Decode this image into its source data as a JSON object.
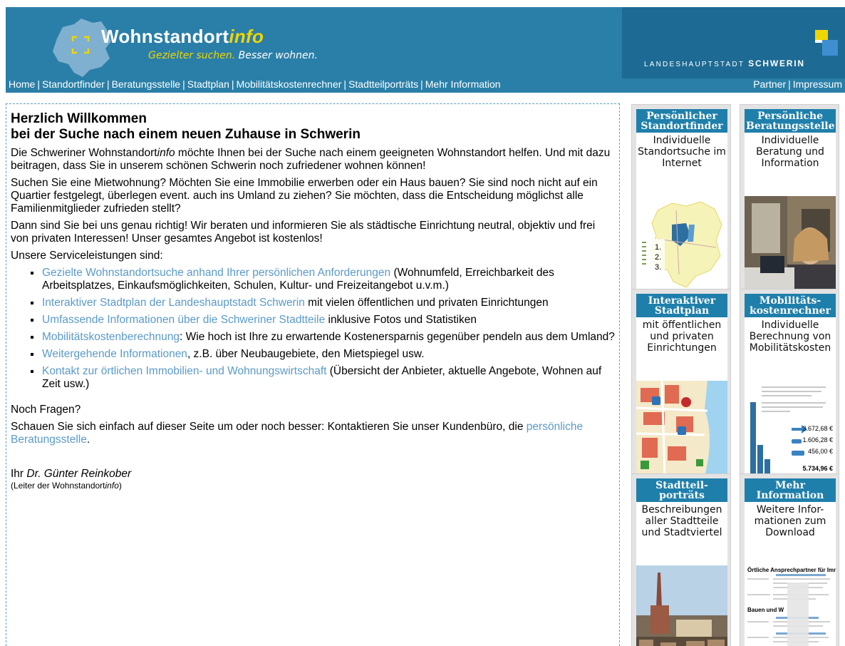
{
  "header": {
    "brand_main": "Wohnstandort",
    "brand_info": "info",
    "tagline_a": "Gezielter suchen.",
    "tagline_b": " Besser wohnen.",
    "city_prefix": "LANDESHAUPTSTADT",
    "city_name": "SCHWERIN",
    "logo_yellow": "#f1d500",
    "header_blue": "#2a7fa8"
  },
  "nav": {
    "left": [
      "Home",
      "Standortfinder",
      "Beratungsstelle",
      "Stadtplan",
      "Mobilitätskostenrechner",
      "Stadtteilporträts",
      "Mehr Information"
    ],
    "right": [
      "Partner",
      "Impressum"
    ],
    "separator": "|"
  },
  "main": {
    "title_line1": "Herzlich Willkommen",
    "title_line2": "bei der Suche nach einem neuen Zuhause in Schwerin",
    "p1_a": "Die Schweriner Wohnstandort",
    "p1_info": "info",
    "p1_b": " möchte Ihnen bei der Suche nach einem geeigneten Wohnstandort helfen. Und mit dazu beitragen, dass Sie in unserem schönen Schwerin noch zufriedener wohnen können!",
    "p2": "Suchen Sie eine Mietwohnung? Möchten Sie eine Immobilie erwerben oder ein Haus bauen? Sie sind noch nicht auf ein Quartier festgelegt, überlegen event. auch ins Umland zu ziehen? Sie möchten, dass die Entscheidung möglichst alle Familienmitglieder zufrieden stellt?",
    "p3": "Dann sind Sie bei uns genau richtig! Wir beraten und informieren Sie als städtische Einrichtung neutral, objektiv und frei von privaten Interessen! Unser gesamtes Angebot ist kostenlos!",
    "p4": "Unsere Serviceleistungen sind:",
    "services": [
      {
        "link": "Gezielte Wohnstandortsuche anhand Ihrer persönlichen Anforderungen",
        "text": " (Wohnumfeld, Erreichbarkeit des Arbeitsplatzes, Einkaufsmöglichkeiten, Schulen, Kultur- und Freizeitangebot u.v.m.)"
      },
      {
        "link": "Interaktiver Stadtplan der Landeshauptstadt Schwerin",
        "text": " mit vielen öffentlichen und privaten Einrichtungen"
      },
      {
        "link": "Umfassende Informationen über die Schweriner Stadtteile",
        "text": " inklusive Fotos und Statistiken"
      },
      {
        "link": "Mobilitätskostenberechnung",
        "text": ": Wie hoch ist Ihre zu erwartende Kostenersparnis gegenüber pendeln aus dem Umland?"
      },
      {
        "link": "Weitergehende Informationen",
        "text": ", z.B. über Neubaugebiete, den Mietspiegel usw."
      },
      {
        "link": "Kontakt zur örtlichen Immobilien- und Wohnungswirtschaft",
        "text": " (Übersicht der Anbieter, aktuelle Angebote, Wohnen auf Zeit usw.)"
      }
    ],
    "q_title": "Noch Fragen?",
    "q_text_a": "Schauen Sie sich einfach auf dieser Seite um oder noch besser: Kontaktieren Sie unser Kundenbüro, die ",
    "q_link": "persönliche Beratungsstelle",
    "q_text_b": ".",
    "sig_prefix": "Ihr ",
    "sig_name": "Dr. Günter Reinkober",
    "sig_role_a": "(Leiter der Wohnstandort",
    "sig_role_info": "info",
    "sig_role_b": ")",
    "link_color": "#5b9ac9"
  },
  "tiles": [
    {
      "title": "Persönlicher Standortfinder",
      "desc": "Individuelle Standortsuche im Internet",
      "image": "district-map-thumbnail",
      "map_labels": [
        "1.",
        "2.",
        "3."
      ]
    },
    {
      "title": "Persönliche Beratungsstelle",
      "desc": "Individuelle Beratung und Information",
      "image": "office-consultation-photo"
    },
    {
      "title": "Interaktiver Stadtplan",
      "desc": "mit öffentlichen und privaten Einrichtungen",
      "image": "city-map-thumbnail"
    },
    {
      "title": "Mobilitäts-kostenrechner",
      "desc": "Individuelle Berechnung von Mobilitätskosten",
      "image": "cost-calculator-thumbnail",
      "amounts": [
        "3.672,68 €",
        "1.606,28 €",
        "456,00 €",
        "5.734,96 €"
      ]
    },
    {
      "title": "Stadtteil-porträts",
      "desc": "Beschreibungen aller Stadtteile und Stadtviertel",
      "image": "city-skyline-photo"
    },
    {
      "title": "Mehr Information",
      "desc": "Weitere Infor-mationen zum Download",
      "image": "document-list-thumbnail",
      "doc_heading": "Örtliche Ansprechpartner für Immo",
      "doc_sub": "Bauen und W"
    }
  ]
}
